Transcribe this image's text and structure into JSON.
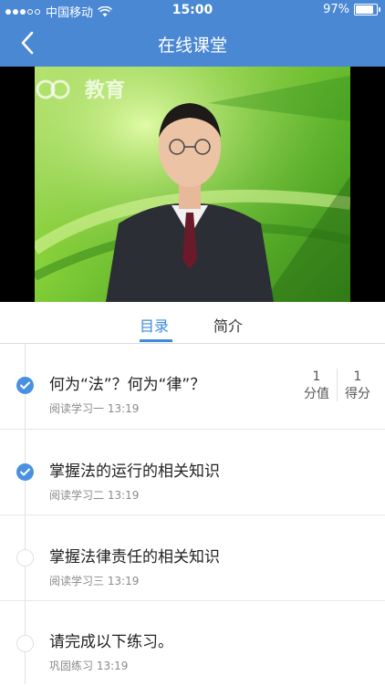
{
  "status_bar": {
    "carrier": "中国移动",
    "time": "15:00",
    "battery": "97%",
    "battery_level": 0.97
  },
  "nav": {
    "title": "在线课堂",
    "back_icon": "chevron-left-icon"
  },
  "video": {
    "watermark": "教育",
    "accent": "#8bd43b"
  },
  "tabs": [
    {
      "label": "目录",
      "active": true
    },
    {
      "label": "简介",
      "active": false
    }
  ],
  "lessons": [
    {
      "title": "何为“法”？何为“律”？",
      "subtitle": "阅读学习一 13:19",
      "completed": true,
      "score_value": "1",
      "score_value_label": "分值",
      "score_got": "1",
      "score_got_label": "得分"
    },
    {
      "title": "掌握法的运行的相关知识",
      "subtitle": "阅读学习二 13:19",
      "completed": true
    },
    {
      "title": "掌握法律责任的相关知识",
      "subtitle": "阅读学习三 13:19",
      "completed": false
    },
    {
      "title": "请完成以下练习。",
      "subtitle": "巩固练习 13:19",
      "completed": false
    }
  ],
  "colors": {
    "header": "#4a88d4",
    "accent": "#3d8be0",
    "check": "#4a90e2"
  }
}
